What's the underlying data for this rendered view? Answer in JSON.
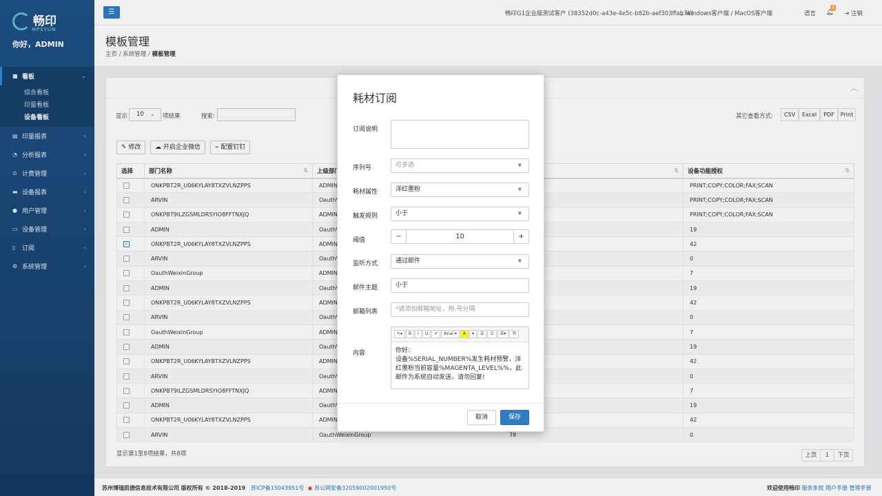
{
  "brand": {
    "name": "畅印",
    "sub": "MPSYUN",
    "greeting": "你好，ADMIN"
  },
  "sidebar": {
    "items": [
      {
        "label": "看板",
        "icon": "dashboard-icon",
        "active": true
      },
      {
        "label": "印量报表",
        "icon": "print-report-icon"
      },
      {
        "label": "分析报表",
        "icon": "pie-chart-icon"
      },
      {
        "label": "计费管理",
        "icon": "billing-icon"
      },
      {
        "label": "设备报表",
        "icon": "device-report-icon"
      },
      {
        "label": "用户管理",
        "icon": "users-icon"
      },
      {
        "label": "设备管理",
        "icon": "monitor-icon"
      },
      {
        "label": "订阅",
        "icon": "subscribe-icon"
      },
      {
        "label": "系统管理",
        "icon": "cogs-icon"
      }
    ],
    "subitems": [
      "综合看板",
      "印量看板",
      "设备看板"
    ]
  },
  "topbar": {
    "tenant": "畅印G1企业版测试客户 (38352d0c-a43e-4e5c-b82b-aef303ffab7e)",
    "download": "Windows客户端 / MacOS客户端",
    "language": "语言",
    "notifications": "3",
    "logout": "注销"
  },
  "header": {
    "title": "模板管理",
    "breadcrumb": [
      "主页",
      "系统管理",
      "模板管理"
    ]
  },
  "list": {
    "show": "显示",
    "page_size": "10",
    "suffix": "项结果",
    "search_label": "搜索:",
    "other_view": "其它查看方式:",
    "exports": [
      "CSV",
      "Excel",
      "PDF",
      "Print"
    ],
    "toolbar": {
      "edit": "修改",
      "wechat": "开启企业微信",
      "dingtalk": "配置钉钉"
    },
    "columns": [
      "选择",
      "部门名称",
      "上级部门",
      "",
      "设备功能授权"
    ],
    "rows": [
      {
        "name": "ONKPBT2R_U06KYLAY8TXZVLNZPPS",
        "parent": "ADMIN",
        "num": "",
        "auth": "PRINT;COPY;COLOR;FAX;SCAN",
        "checked": false
      },
      {
        "name": "ARVIN",
        "parent": "OauthW",
        "num": "",
        "auth": "PRINT;COPY;COLOR;FAX;SCAN",
        "checked": false
      },
      {
        "name": "ONKPBT9ILZGSMLDRSYIO8FFTNXJQ",
        "parent": "ADMIN",
        "num": "",
        "auth": "PRINT;COPY;COLOR;FAX;SCAN",
        "checked": false
      },
      {
        "name": "ADMIN",
        "parent": "OauthW",
        "num": "",
        "auth": "19",
        "checked": false
      },
      {
        "name": "ONKPBT2R_U06KYLAY8TXZVLNZPPS",
        "parent": "ADMIN",
        "num": "",
        "auth": "42",
        "checked": true
      },
      {
        "name": "ARVIN",
        "parent": "OauthW",
        "num": "",
        "auth": "0",
        "checked": false
      },
      {
        "name": "OauthWeixinGroup",
        "parent": "ADMIN",
        "num": "",
        "auth": "7",
        "checked": false
      },
      {
        "name": "ADMIN",
        "parent": "OauthW",
        "num": "",
        "auth": "19",
        "checked": false
      },
      {
        "name": "ONKPBT2R_U06KYLAY8TXZVLNZPPS",
        "parent": "ADMIN",
        "num": "",
        "auth": "42",
        "checked": false
      },
      {
        "name": "ARVIN",
        "parent": "OauthW",
        "num": "",
        "auth": "0",
        "checked": false
      },
      {
        "name": "OauthWeixinGroup",
        "parent": "ADMIN",
        "num": "",
        "auth": "7",
        "checked": false
      },
      {
        "name": "ADMIN",
        "parent": "OauthW",
        "num": "",
        "auth": "19",
        "checked": false
      },
      {
        "name": "ONKPBT2R_U06KYLAY8TXZVLNZPPS",
        "parent": "ADMIN",
        "num": "",
        "auth": "42",
        "checked": false
      },
      {
        "name": "ARVIN",
        "parent": "OauthW",
        "num": "",
        "auth": "0",
        "checked": false
      },
      {
        "name": "ONKPBT9ILZGSMLDRSYIO8FFTNXJQ",
        "parent": "ADMIN",
        "num": "",
        "auth": "7",
        "checked": false
      },
      {
        "name": "ADMIN",
        "parent": "OauthW",
        "num": "",
        "auth": "19",
        "checked": false
      },
      {
        "name": "ONKPBT2R_U06KYLAY8TXZVLNZPPS",
        "parent": "ADMIN",
        "num": "",
        "auth": "42",
        "checked": false
      },
      {
        "name": "ARVIN",
        "parent": "OauthWeixinGroup",
        "num": "78",
        "auth": "0",
        "checked": false
      }
    ],
    "info": "显示第1至8项结果，共8项",
    "pager": {
      "prev": "上页",
      "page": "1",
      "next": "下页"
    }
  },
  "footer": {
    "copyright": "苏州博瑞凯德信息技术有限公司 版权所有 © 2018-2019",
    "icp": "苏ICP备15043951号",
    "police": "苏公网安备32059002001950号",
    "welcome": "欢迎使用畅印",
    "links": [
      "服务条款",
      "用户手册",
      "管理手册"
    ]
  },
  "modal": {
    "title": "耗材订阅",
    "fields": {
      "desc": {
        "label": "订阅说明",
        "value": ""
      },
      "serial": {
        "label": "序列号",
        "placeholder": "可多选"
      },
      "attr": {
        "label": "耗材属性",
        "value": "洋红墨粉"
      },
      "rule": {
        "label": "触发规则",
        "value": "小于"
      },
      "threshold": {
        "label": "阈值",
        "value": "10"
      },
      "monitor": {
        "label": "监听方式",
        "value": "通过邮件"
      },
      "subject": {
        "label": "邮件主题",
        "value": "小于"
      },
      "emails": {
        "label": "邮箱列表",
        "placeholder": "*请添加邮箱地址，用;号分隔"
      },
      "content": {
        "label": "内容",
        "value": "你好:\n设备%SERIAL_NUMBER%发生耗材预警，洋红墨粉当前容量%MAGENTA_LEVEL%%，此邮件为系统自动发送，请勿回复!"
      }
    },
    "editor_tools": [
      "✎▾",
      "B",
      "I",
      "U",
      "✐",
      "Arial ▾",
      "A",
      "▾",
      "☰",
      "☷",
      "☰▾",
      "Tt"
    ],
    "cancel": "取消",
    "save": "保存"
  }
}
